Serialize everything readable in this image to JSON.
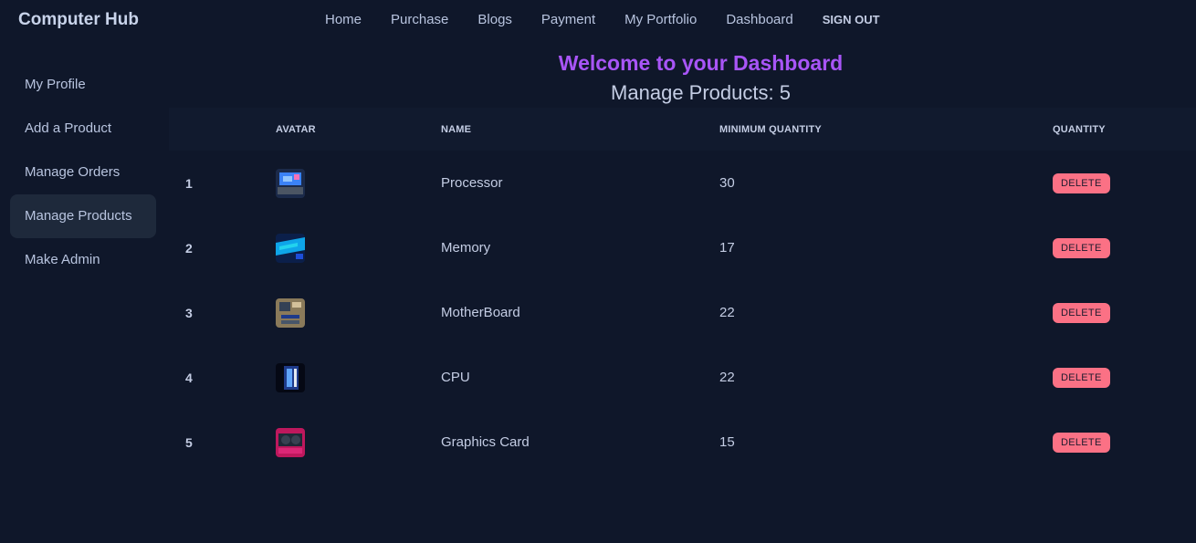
{
  "brand": "Computer Hub",
  "nav": [
    "Home",
    "Purchase",
    "Blogs",
    "Payment",
    "My Portfolio",
    "Dashboard"
  ],
  "signout": "SIGN OUT",
  "sidebar": [
    "My Profile",
    "Add a Product",
    "Manage Orders",
    "Manage Products",
    "Make Admin"
  ],
  "active_sidebar": "Manage Products",
  "welcome": "Welcome to your Dashboard",
  "subtitle": "Manage Products: 5",
  "table": {
    "headers": [
      "AVATAR",
      "NAME",
      "MINIMUM QUANTITY",
      "QUANTITY"
    ],
    "rows": [
      {
        "index": "1",
        "name": "Processor",
        "min_quantity": "30",
        "action": "DELETE"
      },
      {
        "index": "2",
        "name": "Memory",
        "min_quantity": "17",
        "action": "DELETE"
      },
      {
        "index": "3",
        "name": "MotherBoard",
        "min_quantity": "22",
        "action": "DELETE"
      },
      {
        "index": "4",
        "name": "CPU",
        "min_quantity": "22",
        "action": "DELETE"
      },
      {
        "index": "5",
        "name": "Graphics Card",
        "min_quantity": "15",
        "action": "DELETE"
      }
    ]
  },
  "colors": {
    "background": "#0f172a",
    "accent": "#a855f7",
    "delete": "#fb7185",
    "active_item": "#1e293b"
  }
}
